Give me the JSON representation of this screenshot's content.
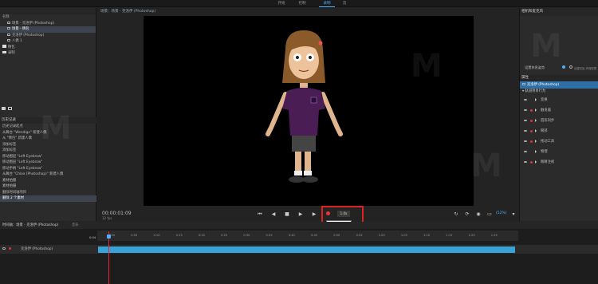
{
  "top_tabs": [
    "开始",
    "控制",
    "录制",
    "流"
  ],
  "left_top": {
    "title": "名称",
    "items": [
      {
        "label": "场景 - 克洛伊 (Photoshop)",
        "icon": "scene-icon",
        "selected": false
      },
      {
        "label": "场景 - 情包",
        "icon": "scene-icon",
        "selected": true
      },
      {
        "label": "克洛伊 (Photoshop)",
        "icon": "puppet-icon",
        "selected": false
      },
      {
        "label": "人偶 1",
        "icon": "puppet-icon",
        "selected": false
      },
      {
        "label": "情包",
        "icon": "folder-icon",
        "selected": false
      },
      {
        "label": "录制",
        "icon": "folder-icon",
        "selected": false
      }
    ]
  },
  "history": {
    "title": "历史记录",
    "items": [
      "历史记录起点",
      "从舞台 \"Wendigo\" 新建人偶",
      "从 \"情包\" 新建人偶",
      "添加标签",
      "添加标签",
      "移动图层 \"Left Eyebrow\"",
      "移动图层 \"Left Eyebrow\"",
      "移动手柄 \"Left Eyebrow\"",
      "从舞台 \"Chloe (Photoshop)\" 新建人偶",
      "素材拍摄",
      "素材拍摄",
      "删除时间轴项目",
      "删除 2 个素材"
    ],
    "selected_index": 12
  },
  "stage": {
    "title": "场景：场景 - 克洛伊 (Photoshop)",
    "timecode": "00:00:01:09",
    "fps": "12 fps",
    "speed": "1.0x",
    "tooltip": "录制 (Ctrl+R)",
    "zoom": "(52%)"
  },
  "right": {
    "camera_title": "相机和麦克风",
    "mic_label": "设置休息姿势",
    "mic_sub": "创建初始 声音配置",
    "props_title": "属性",
    "puppet_name": "克洛伊 (Photoshop)",
    "behaviors_header": "轨道项目行为",
    "behaviors": [
      "变换",
      "触发器",
      "唇形同步",
      "眼部",
      "拖动工具",
      "物理",
      "眼睛注视"
    ]
  },
  "timeline": {
    "tabs": [
      "时间轴：场景 - 克洛伊 (Photoshop)",
      "音乐"
    ],
    "ticks": [
      "0:00",
      "0:05",
      "0:10",
      "0:15",
      "0:20",
      "0:25",
      "0:30",
      "0:35",
      "0:40",
      "0:45",
      "0:50",
      "0:55",
      "1:00",
      "1:05",
      "1:10",
      "1:15",
      "1:20",
      "1:25"
    ],
    "current": "0:04",
    "track_label": "克洛伊 (Photoshop)"
  }
}
